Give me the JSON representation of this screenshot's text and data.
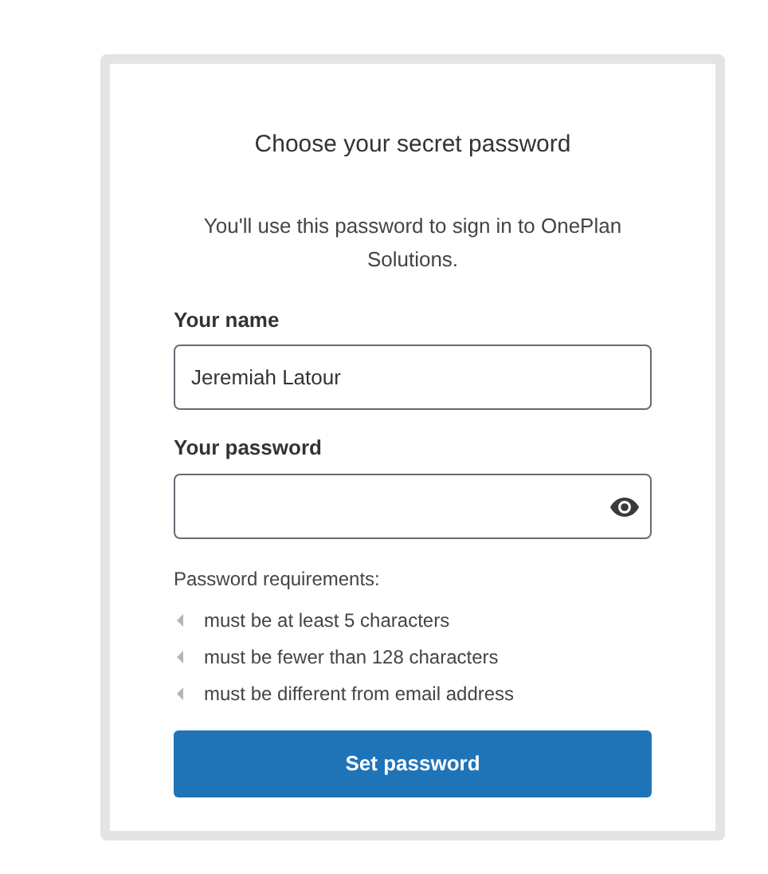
{
  "title": "Choose your secret password",
  "subtitle": "You'll use this password to sign in to OnePlan Solutions.",
  "fields": [
    {
      "label": "Your name",
      "value": "Jeremiah Latour",
      "kind": "text"
    },
    {
      "label": "Your password",
      "kind": "password"
    }
  ],
  "requirements": {
    "heading": "Password requirements:",
    "items": [
      "must be at least 5 characters",
      "must be fewer than 128 characters",
      "must be different from email address"
    ]
  },
  "button": "Set password"
}
